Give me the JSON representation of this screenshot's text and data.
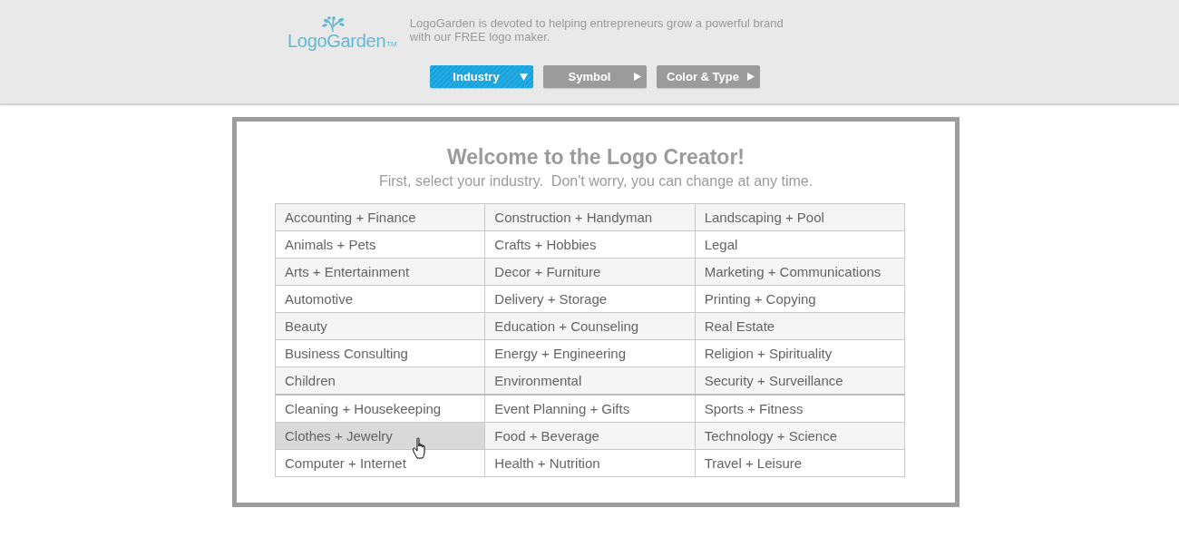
{
  "header": {
    "logo": {
      "text": "LogoGarden",
      "trademark": "TM"
    },
    "tagline": "LogoGarden is devoted to helping entrepreneurs grow a powerful brand with our FREE logo maker.",
    "steps": [
      {
        "label": "Industry",
        "selected": true
      },
      {
        "label": "Symbol",
        "selected": false
      },
      {
        "label": "Color & Type",
        "selected": false
      }
    ]
  },
  "creator": {
    "title": "Welcome to the Logo Creator!",
    "subtitle": "First, select your industry.  Don't worry, you can change at any time.",
    "industries": {
      "rows": [
        {
          "cells": [
            {
              "label": "Accounting + Finance",
              "hovered": false
            },
            {
              "label": "Construction + Handyman",
              "hovered": false
            },
            {
              "label": "Landscaping + Pool",
              "hovered": false
            }
          ]
        },
        {
          "cells": [
            {
              "label": "Animals + Pets",
              "hovered": false
            },
            {
              "label": "Crafts + Hobbies",
              "hovered": false
            },
            {
              "label": "Legal",
              "hovered": false
            }
          ]
        },
        {
          "cells": [
            {
              "label": "Arts + Entertainment",
              "hovered": false
            },
            {
              "label": "Decor + Furniture",
              "hovered": false
            },
            {
              "label": "Marketing + Communications",
              "hovered": false
            }
          ]
        },
        {
          "cells": [
            {
              "label": "Automotive",
              "hovered": false
            },
            {
              "label": "Delivery + Storage",
              "hovered": false
            },
            {
              "label": "Printing + Copying",
              "hovered": false
            }
          ]
        },
        {
          "cells": [
            {
              "label": "Beauty",
              "hovered": false
            },
            {
              "label": "Education + Counseling",
              "hovered": false
            },
            {
              "label": "Real Estate",
              "hovered": false
            }
          ]
        },
        {
          "cells": [
            {
              "label": "Business Consulting",
              "hovered": false
            },
            {
              "label": "Energy + Engineering",
              "hovered": false
            },
            {
              "label": "Religion + Spirituality",
              "hovered": false
            }
          ]
        },
        {
          "cells": [
            {
              "label": "Children",
              "hovered": false
            },
            {
              "label": "Environmental",
              "hovered": false
            },
            {
              "label": "Security + Surveillance",
              "hovered": false
            }
          ]
        },
        {
          "cells": [
            {
              "label": "Cleaning + Housekeeping",
              "hovered": false
            },
            {
              "label": "Event Planning + Gifts",
              "hovered": false
            },
            {
              "label": "Sports + Fitness",
              "hovered": false
            }
          ]
        },
        {
          "cells": [
            {
              "label": "Clothes + Jewelry",
              "hovered": true
            },
            {
              "label": "Food + Beverage",
              "hovered": false
            },
            {
              "label": "Technology + Science",
              "hovered": false
            }
          ]
        },
        {
          "cells": [
            {
              "label": "Computer + Internet",
              "hovered": false
            },
            {
              "label": "Health + Nutrition",
              "hovered": false
            },
            {
              "label": "Travel + Leisure",
              "hovered": false
            }
          ]
        }
      ]
    }
  }
}
